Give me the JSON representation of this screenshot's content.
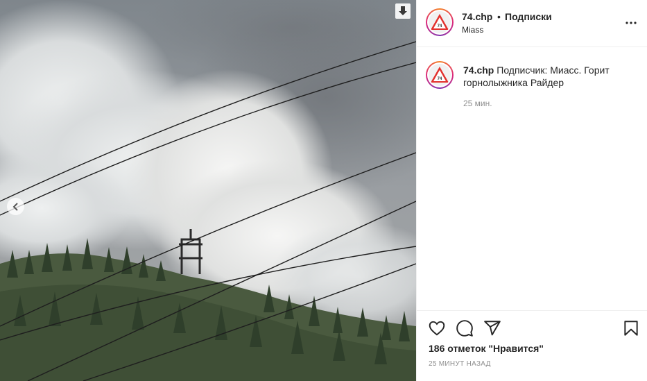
{
  "header": {
    "username": "74.chp",
    "separator": "•",
    "follow_label": "Подписки",
    "location": "Miass",
    "avatar_text": "74.CHP"
  },
  "caption": {
    "username": "74.chp",
    "text": "Подписчик: Миасс. Горит горнолыжника Райдер",
    "time": "25 мин."
  },
  "actions": {
    "like_icon": "heart-outline-icon",
    "comment_icon": "comment-icon",
    "share_icon": "paper-plane-icon",
    "save_icon": "bookmark-icon"
  },
  "likes": "186 отметок \"Нравится\"",
  "posted": "25 МИНУТ НАЗАД",
  "colors": {
    "text": "#262626",
    "muted": "#8e8e8e",
    "border": "#efefef",
    "avatar_ring_start": "#f58529",
    "avatar_ring_end": "#dd2a7b",
    "logo_red": "#e3312d"
  }
}
